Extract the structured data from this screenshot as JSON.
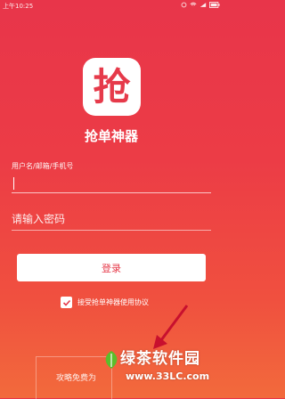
{
  "status_bar": {
    "time": "上午10:25"
  },
  "app": {
    "icon_char": "抢",
    "name": "抢单神器",
    "brand_color": "#e63a4a"
  },
  "login_form": {
    "username_label": "用户名/邮箱/手机号",
    "password_placeholder": "请输入密码",
    "login_button": "登录",
    "agree_text": "接受抢单神器使用协议",
    "agree_checked": true
  },
  "bottom_link": "攻略免费为",
  "watermark": {
    "title": "绿茶软件园",
    "url": "www.33LC.com"
  },
  "annotation": {
    "arrow_color": "#c8102e"
  }
}
